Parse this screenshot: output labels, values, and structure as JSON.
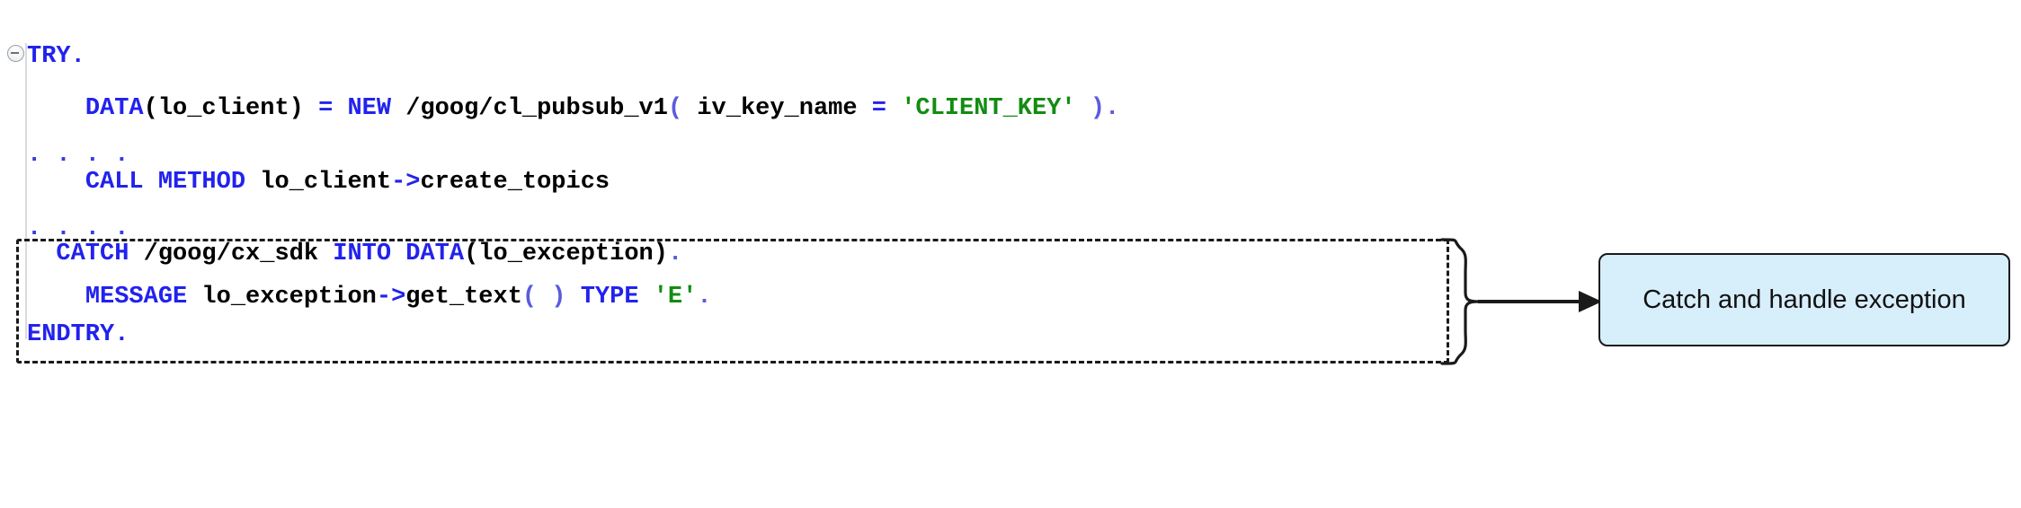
{
  "editor": {
    "language": "ABAP",
    "fold_icon": "collapse-minus-icon",
    "colors": {
      "background": "#ffffff",
      "keyword": "#2222ee",
      "identifier": "#000000",
      "string": "#128c12",
      "punctuation": "#5b5bdd",
      "fold_guide": "#d9d9e0"
    },
    "lines": [
      {
        "id": "line-try",
        "tokens": [
          {
            "t": "TRY.",
            "c": "kw"
          }
        ]
      },
      {
        "id": "line-data-new-client",
        "tokens": [
          {
            "t": "    ",
            "c": "pl"
          },
          {
            "t": "DATA",
            "c": "kw"
          },
          {
            "t": "(lo_client)",
            "c": "pl"
          },
          {
            "t": " ",
            "c": "pl"
          },
          {
            "t": "=",
            "c": "kw"
          },
          {
            "t": " ",
            "c": "pl"
          },
          {
            "t": "NEW",
            "c": "kw"
          },
          {
            "t": " /goog/cl_pubsub_v1",
            "c": "pl"
          },
          {
            "t": "(",
            "c": "pn"
          },
          {
            "t": " iv_key_name ",
            "c": "pl"
          },
          {
            "t": "=",
            "c": "kw"
          },
          {
            "t": " ",
            "c": "pl"
          },
          {
            "t": "'CLIENT_KEY'",
            "c": "str"
          },
          {
            "t": " ",
            "c": "pl"
          },
          {
            "t": ")",
            "c": "pn"
          },
          {
            "t": ".",
            "c": "pn"
          }
        ]
      },
      {
        "id": "line-ellipsis-1",
        "tokens": [
          {
            "t": ". . . .",
            "c": "dots"
          }
        ]
      },
      {
        "id": "line-call-method",
        "tokens": [
          {
            "t": "    ",
            "c": "pl"
          },
          {
            "t": "CALL METHOD",
            "c": "kw"
          },
          {
            "t": " lo_client",
            "c": "pl"
          },
          {
            "t": "->",
            "c": "kw"
          },
          {
            "t": "create_topics",
            "c": "pl"
          }
        ]
      },
      {
        "id": "line-ellipsis-2",
        "tokens": [
          {
            "t": ". . . .",
            "c": "dots"
          }
        ]
      },
      {
        "id": "line-catch",
        "tokens": [
          {
            "t": "  ",
            "c": "pl"
          },
          {
            "t": "CATCH",
            "c": "kw"
          },
          {
            "t": " /goog/cx_sdk ",
            "c": "pl"
          },
          {
            "t": "INTO",
            "c": "kw"
          },
          {
            "t": " ",
            "c": "pl"
          },
          {
            "t": "DATA",
            "c": "kw"
          },
          {
            "t": "(lo_exception)",
            "c": "pl"
          },
          {
            "t": ".",
            "c": "pn"
          }
        ]
      },
      {
        "id": "line-message",
        "tokens": [
          {
            "t": "    ",
            "c": "pl"
          },
          {
            "t": "MESSAGE",
            "c": "kw"
          },
          {
            "t": " lo_exception",
            "c": "pl"
          },
          {
            "t": "->",
            "c": "kw"
          },
          {
            "t": "get_text",
            "c": "pl"
          },
          {
            "t": "( )",
            "c": "pn"
          },
          {
            "t": " ",
            "c": "pl"
          },
          {
            "t": "TYPE",
            "c": "kw"
          },
          {
            "t": " ",
            "c": "pl"
          },
          {
            "t": "'E'",
            "c": "str"
          },
          {
            "t": ".",
            "c": "pn"
          }
        ]
      },
      {
        "id": "line-endtry",
        "tokens": [
          {
            "t": "ENDTRY.",
            "c": "kw"
          }
        ]
      }
    ],
    "plain_text": "TRY.\n    DATA(lo_client) = NEW /goog/cl_pubsub_v1( iv_key_name = 'CLIENT_KEY' ).\n. . . .\n    CALL METHOD lo_client->create_topics\n. . . .\n  CATCH /goog/cx_sdk INTO DATA(lo_exception).\n    MESSAGE lo_exception->get_text( ) TYPE 'E'.\nENDTRY."
  },
  "annotation": {
    "highlight_box": {
      "style": "dashed",
      "color": "#1a1a1a"
    },
    "brace": "curly-brace-right",
    "arrow": "arrow-right-icon",
    "callout": {
      "label": "Catch and handle exception",
      "fill": "#d7eefb",
      "border": "#1a1a1a"
    }
  }
}
